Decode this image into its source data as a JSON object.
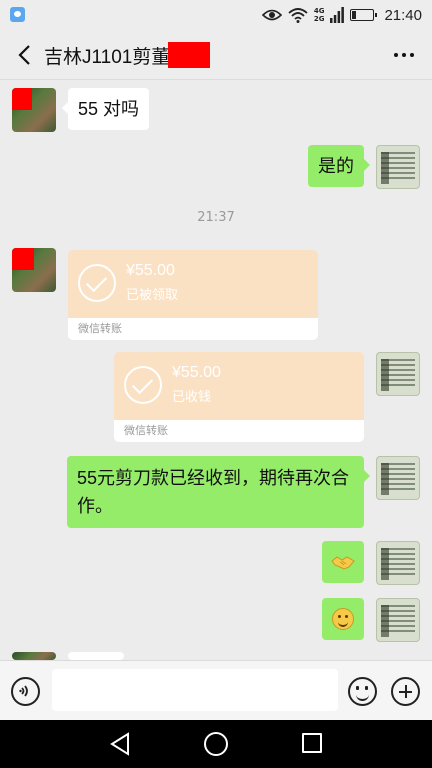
{
  "status_bar": {
    "network_top": "4G",
    "network_bottom": "2G",
    "time": "21:40",
    "battery_percent": 20
  },
  "header": {
    "title": "吉林J1101剪董"
  },
  "messages": {
    "m1": {
      "text": "55 对吗"
    },
    "m2": {
      "text": "是的"
    },
    "timestamp": "21:37",
    "transfer_in": {
      "amount": "¥55.00",
      "status": "已被领取",
      "footer": "微信转账"
    },
    "transfer_out": {
      "amount": "¥55.00",
      "status": "已收钱",
      "footer": "微信转账"
    },
    "m3": {
      "text": "55元剪刀款已经收到，期待再次合作。"
    },
    "emoji1": {
      "icon": "handshake-icon"
    },
    "emoji2": {
      "icon": "smile-icon"
    }
  },
  "input": {
    "placeholder": ""
  },
  "colors": {
    "outgoing_bubble": "#95ec69",
    "transfer_card": "#fbe1c3",
    "redaction": "#ff0000"
  }
}
